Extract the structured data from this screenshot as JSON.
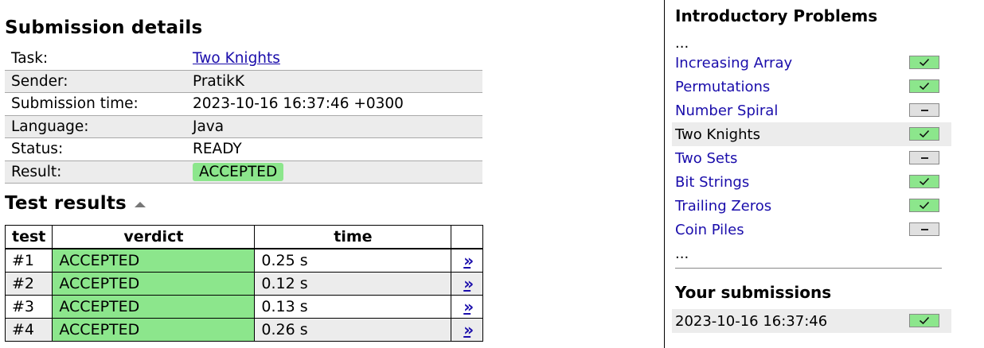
{
  "submission": {
    "title": "Submission details",
    "rows": [
      {
        "label": "Task:",
        "value": "Two Knights",
        "kind": "link"
      },
      {
        "label": "Sender:",
        "value": "PratikK",
        "kind": "text"
      },
      {
        "label": "Submission time:",
        "value": "2023-10-16 16:37:46 +0300",
        "kind": "text"
      },
      {
        "label": "Language:",
        "value": "Java",
        "kind": "text"
      },
      {
        "label": "Status:",
        "value": "READY",
        "kind": "text"
      },
      {
        "label": "Result:",
        "value": "ACCEPTED",
        "kind": "badge"
      }
    ]
  },
  "tests": {
    "title": "Test results",
    "headers": [
      "test",
      "verdict",
      "time",
      ""
    ],
    "rows": [
      {
        "test": "#1",
        "verdict": "ACCEPTED",
        "time": "0.25 s",
        "link": "»"
      },
      {
        "test": "#2",
        "verdict": "ACCEPTED",
        "time": "0.12 s",
        "link": "»"
      },
      {
        "test": "#3",
        "verdict": "ACCEPTED",
        "time": "0.13 s",
        "link": "»"
      },
      {
        "test": "#4",
        "verdict": "ACCEPTED",
        "time": "0.26 s",
        "link": "»"
      }
    ]
  },
  "sidebar": {
    "title": "Introductory Problems",
    "ellipsis": "...",
    "problems": [
      {
        "name": "Increasing Array",
        "status": "solved",
        "current": false
      },
      {
        "name": "Permutations",
        "status": "solved",
        "current": false
      },
      {
        "name": "Number Spiral",
        "status": "unsolved",
        "current": false
      },
      {
        "name": "Two Knights",
        "status": "solved",
        "current": true
      },
      {
        "name": "Two Sets",
        "status": "unsolved",
        "current": false
      },
      {
        "name": "Bit Strings",
        "status": "solved",
        "current": false
      },
      {
        "name": "Trailing Zeros",
        "status": "solved",
        "current": false
      },
      {
        "name": "Coin Piles",
        "status": "unsolved",
        "current": false
      }
    ],
    "submissions_title": "Your submissions",
    "submissions": [
      {
        "time": "2023-10-16 16:37:46",
        "status": "solved"
      }
    ]
  },
  "colors": {
    "accepted": "#8ce68c",
    "link": "#1a0dab",
    "highlight": "#ececec"
  }
}
